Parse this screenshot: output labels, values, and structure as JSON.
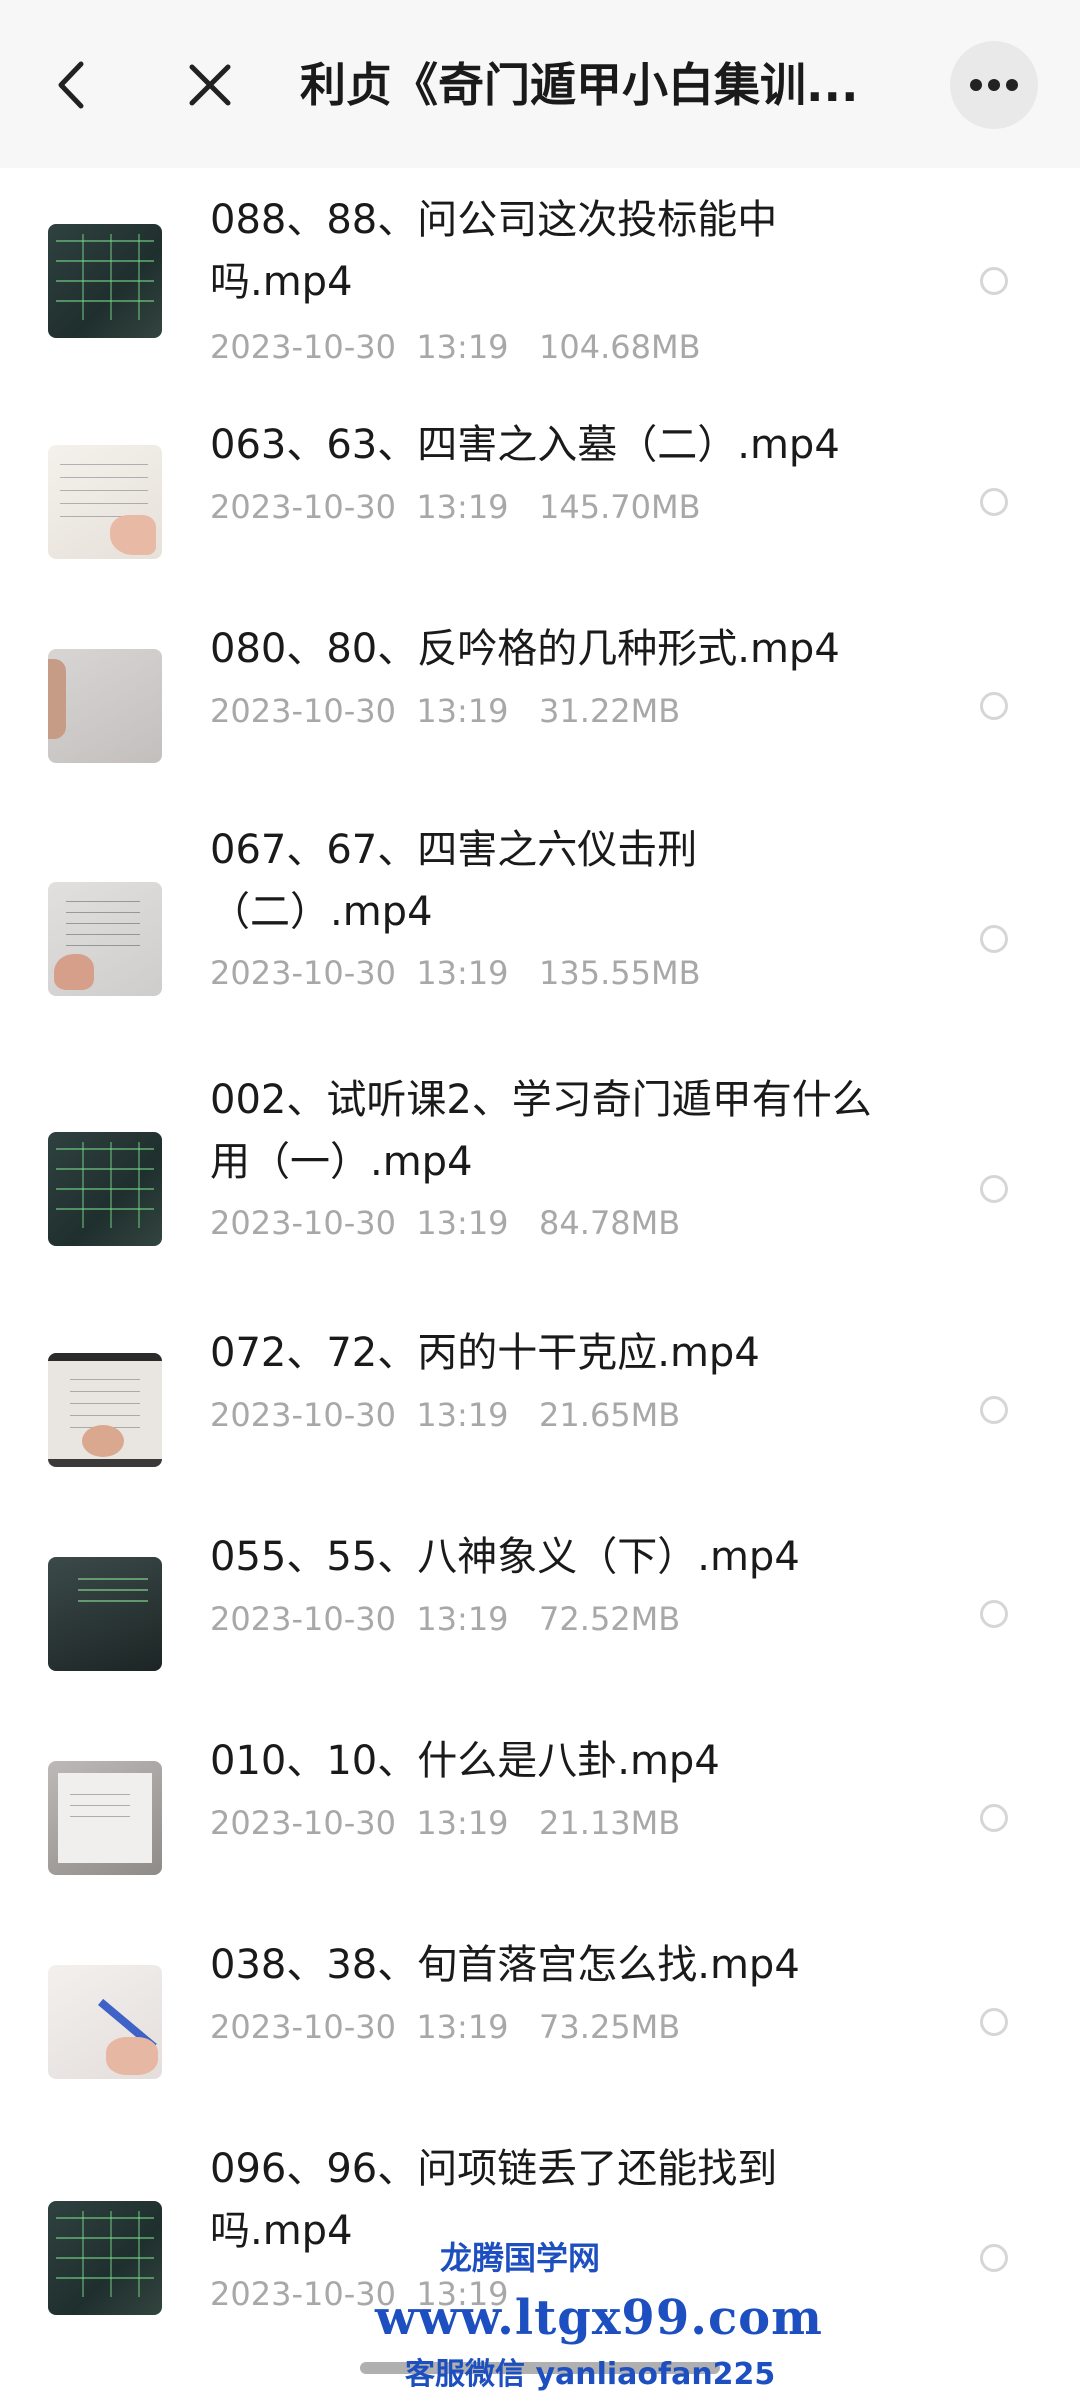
{
  "header": {
    "title": "利贞《奇门遁甲小白集训...",
    "back_icon": "chevron-left-icon",
    "close_icon": "close-icon",
    "more_icon": "more-horizontal-icon"
  },
  "files": [
    {
      "name_lines": [
        "088、88、问公司这次投标能中",
        "吗.mp4"
      ],
      "meta": "2023-10-30  13:19   104.68MB",
      "thumb": "board-dark"
    },
    {
      "name_lines": [
        "063、63、四害之入墓（二）.mp4"
      ],
      "meta": "2023-10-30  13:19   145.70MB",
      "thumb": "paper"
    },
    {
      "name_lines": [
        "080、80、反吟格的几种形式.mp4"
      ],
      "meta": "2023-10-30  13:19   31.22MB",
      "thumb": "paper-grey"
    },
    {
      "name_lines": [
        "067、67、四害之六仪击刑",
        "（二）.mp4"
      ],
      "meta": "2023-10-30  13:19   135.55MB",
      "thumb": "whiteboard"
    },
    {
      "name_lines": [
        "002、试听课2、学习奇门遁甲有什么",
        "用（一）.mp4"
      ],
      "meta": "2023-10-30  13:19   84.78MB",
      "thumb": "board-dark"
    },
    {
      "name_lines": [
        "072、72、丙的十干克应.mp4"
      ],
      "meta": "2023-10-30  13:19   21.65MB",
      "thumb": "stand"
    },
    {
      "name_lines": [
        "055、55、八神象义（下）.mp4"
      ],
      "meta": "2023-10-30  13:19   72.52MB",
      "thumb": "board-dark-plain"
    },
    {
      "name_lines": [
        "010、10、什么是八卦.mp4"
      ],
      "meta": "2023-10-30  13:19   21.13MB",
      "thumb": "grey-board"
    },
    {
      "name_lines": [
        "038、38、旬首落宫怎么找.mp4"
      ],
      "meta": "2023-10-30  13:19   73.25MB",
      "thumb": "pen"
    },
    {
      "name_lines": [
        "096、96、问项链丢了还能找到",
        "吗.mp4"
      ],
      "meta": "2023-10-30  13:19",
      "thumb": "board-dark"
    }
  ],
  "watermark": {
    "name": "龙腾国学网",
    "url": "www.ltgx99.com",
    "contact": "客服微信 yanliaofan225"
  },
  "colors": {
    "header_bg": "#f7f7f7",
    "meta_text": "#a8a8a8",
    "radio_border": "#d6d6d6",
    "watermark": "#1d4fc0"
  }
}
